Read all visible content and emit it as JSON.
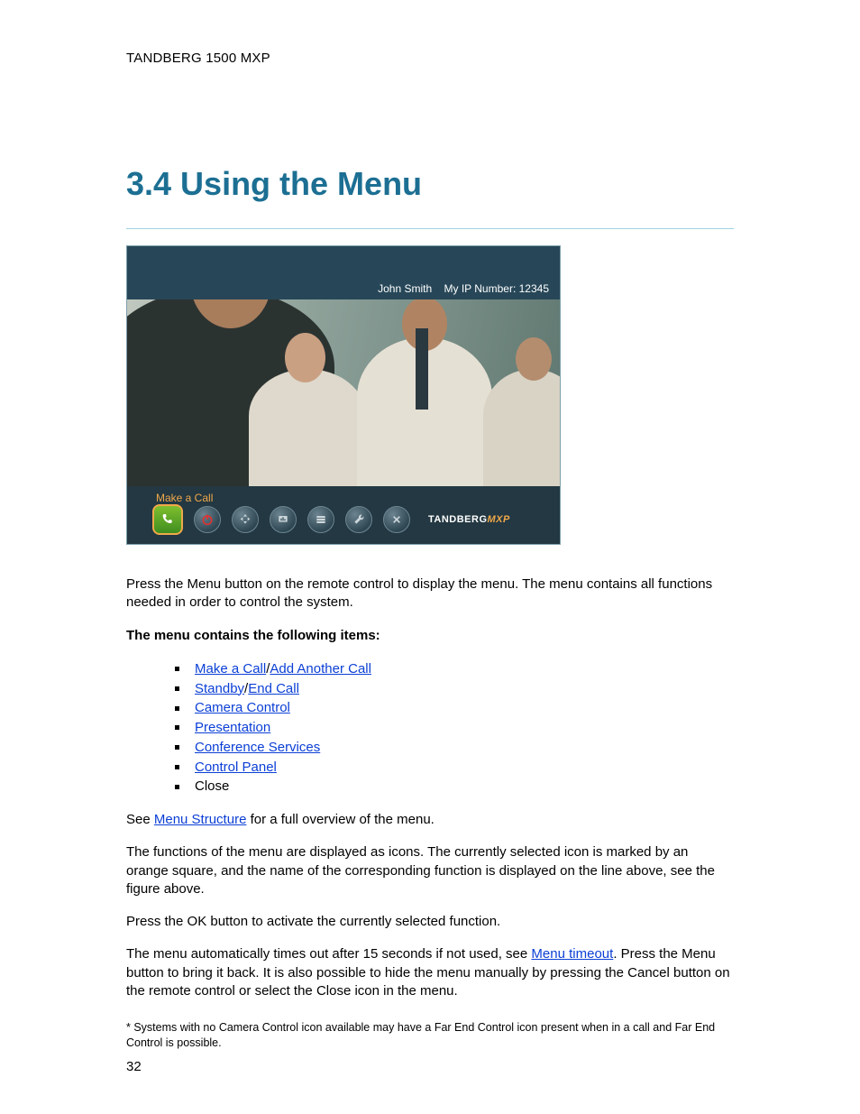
{
  "header": {
    "product": "TANDBERG 1500 MXP"
  },
  "section": {
    "title": "3.4 Using the Menu"
  },
  "screenshot": {
    "status_left": "John Smith",
    "status_right": "My IP Number: 12345",
    "selected_label": "Make a Call",
    "brand": "TANDBERG",
    "brand_suffix": "MXP",
    "icons": {
      "call": "call-icon",
      "standby": "power-icon",
      "camera": "camera-control-icon",
      "presentation": "presentation-icon",
      "conference": "conference-services-icon",
      "control_panel": "wrench-icon",
      "close": "close-icon"
    }
  },
  "paragraphs": {
    "intro": "Press the Menu button on the remote control to display the menu. The menu contains all functions needed in order to control the system.",
    "list_heading": "The menu contains the following items:",
    "see_prefix": "See ",
    "see_link": "Menu Structure",
    "see_suffix": " for a full overview of the menu.",
    "p_icons": "The functions of the menu are displayed as icons. The currently selected icon is marked by an orange square, and the name of the corresponding function is displayed on the line above, see the figure above.",
    "p_ok": "Press the OK button to activate the currently selected function.",
    "p_timeout_a": "The menu automatically times out after 15 seconds if not used, see ",
    "p_timeout_link": "Menu timeout",
    "p_timeout_b": ". Press the Menu button to bring it back. It is also possible to hide the menu manually by pressing the Cancel button on the remote control or select the Close icon in the menu.",
    "footnote": "* Systems with no Camera Control icon available may have a Far End Control icon present when in a call and Far End Control is possible."
  },
  "list": {
    "slash": "/",
    "item1a": "Make a Call",
    "item1b": "Add Another Call",
    "item2a": "Standby",
    "item2b": "End Call",
    "item3": "Camera Control",
    "item4": "Presentation",
    "item5": "Conference Services",
    "item6": "Control Panel",
    "item7": "Close"
  },
  "page_number": "32"
}
